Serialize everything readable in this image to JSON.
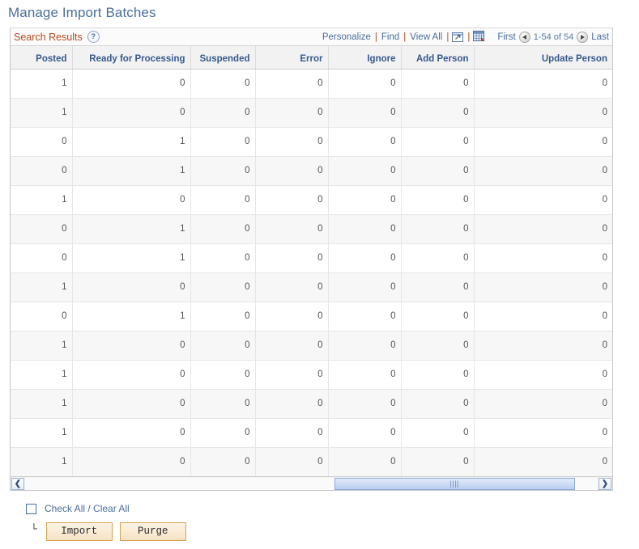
{
  "page": {
    "title": "Manage Import Batches"
  },
  "grid": {
    "caption": "Search Results",
    "help_icon_label": "?",
    "toolbar": {
      "personalize": "Personalize",
      "find": "Find",
      "view_all": "View All",
      "sep": "|",
      "zoom_icon": "expand-grid-icon",
      "download_icon": "download-to-spreadsheet-icon"
    },
    "pager": {
      "first": "First",
      "prev_icon": "previous-page-icon",
      "range": "1-54 of 54",
      "next_icon": "next-page-icon",
      "last": "Last"
    },
    "columns": [
      "Posted",
      "Ready for Processing",
      "Suspended",
      "Error",
      "Ignore",
      "Add Person",
      "Update Person"
    ],
    "rows": [
      [
        "1",
        "0",
        "0",
        "0",
        "0",
        "0",
        "0"
      ],
      [
        "1",
        "0",
        "0",
        "0",
        "0",
        "0",
        "0"
      ],
      [
        "0",
        "1",
        "0",
        "0",
        "0",
        "0",
        "0"
      ],
      [
        "0",
        "1",
        "0",
        "0",
        "0",
        "0",
        "0"
      ],
      [
        "1",
        "0",
        "0",
        "0",
        "0",
        "0",
        "0"
      ],
      [
        "0",
        "1",
        "0",
        "0",
        "0",
        "0",
        "0"
      ],
      [
        "0",
        "1",
        "0",
        "0",
        "0",
        "0",
        "0"
      ],
      [
        "1",
        "0",
        "0",
        "0",
        "0",
        "0",
        "0"
      ],
      [
        "0",
        "1",
        "0",
        "0",
        "0",
        "0",
        "0"
      ],
      [
        "1",
        "0",
        "0",
        "0",
        "0",
        "0",
        "0"
      ],
      [
        "1",
        "0",
        "0",
        "0",
        "0",
        "0",
        "0"
      ],
      [
        "1",
        "0",
        "0",
        "0",
        "0",
        "0",
        "0"
      ],
      [
        "1",
        "0",
        "0",
        "0",
        "0",
        "0",
        "0"
      ],
      [
        "1",
        "0",
        "0",
        "0",
        "0",
        "0",
        "0"
      ]
    ],
    "scrollbar": {
      "left_arrow": "❮",
      "right_arrow": "❯",
      "grip": "||||"
    }
  },
  "footer": {
    "check_all_label": "Check All / Clear All",
    "tree_elbow": "└",
    "import_label": "Import",
    "purge_label": "Purge"
  },
  "colors": {
    "title": "#4a6f9c",
    "caption": "#b04a1e",
    "header_text": "#36598c",
    "button_face": "#f6e3c6",
    "button_border": "#d9a24e",
    "scroll_thumb": "#b9cdf0"
  }
}
